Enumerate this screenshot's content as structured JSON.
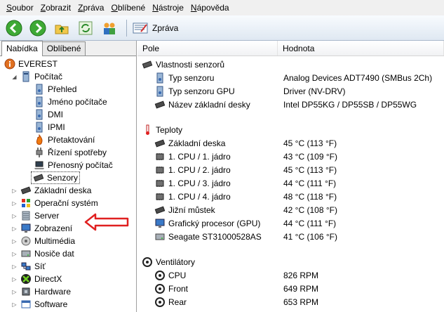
{
  "menu": [
    {
      "u": "S",
      "rest": "oubor"
    },
    {
      "u": "Z",
      "rest": "obrazit"
    },
    {
      "u": "Z",
      "rest": "práva"
    },
    {
      "u": "O",
      "rest": "blíbené"
    },
    {
      "u": "N",
      "rest": "ástroje"
    },
    {
      "u": "N",
      "rest": "ápověda"
    }
  ],
  "toolbar": {
    "title": "Zpráva"
  },
  "tabs": {
    "tab1": "Nabídka",
    "tab2": "Oblíbené"
  },
  "tree": {
    "root": "EVEREST",
    "computer": "Počítač",
    "items": [
      "Přehled",
      "Jméno počítače",
      "DMI",
      "IPMI",
      "Přetaktování",
      "Řízení spotřeby",
      "Přenosný počítač",
      "Senzory"
    ],
    "groups": [
      "Základní deska",
      "Operační systém",
      "Server",
      "Zobrazení",
      "Multimédia",
      "Nosiče dat",
      "Síť",
      "DirectX",
      "Hardware",
      "Software"
    ]
  },
  "columns": {
    "field": "Pole",
    "value": "Hodnota"
  },
  "sections": {
    "props": "Vlastnosti senzorů",
    "temps": "Teploty",
    "fans": "Ventilátory"
  },
  "props": [
    {
      "label": "Typ senzoru",
      "value": "Analog Devices ADT7490  (SMBus 2Ch)"
    },
    {
      "label": "Typ senzoru GPU",
      "value": "Driver  (NV-DRV)"
    },
    {
      "label": "Název základní desky",
      "value": "Intel DP55KG / DP55SB / DP55WG"
    }
  ],
  "temps": [
    {
      "label": "Základní deska",
      "value": "45 °C  (113 °F)"
    },
    {
      "label": "1. CPU / 1. jádro",
      "value": "43 °C  (109 °F)"
    },
    {
      "label": "1. CPU / 2. jádro",
      "value": "45 °C  (113 °F)"
    },
    {
      "label": "1. CPU / 3. jádro",
      "value": "44 °C  (111 °F)"
    },
    {
      "label": "1. CPU / 4. jádro",
      "value": "48 °C  (118 °F)"
    },
    {
      "label": "Jižní můstek",
      "value": "42 °C  (108 °F)"
    },
    {
      "label": "Grafický procesor (GPU)",
      "value": "44 °C  (111 °F)"
    },
    {
      "label": "Seagate ST31000528AS",
      "value": "41 °C  (106 °F)"
    }
  ],
  "fans": [
    {
      "label": "CPU",
      "value": "826 RPM"
    },
    {
      "label": "Front",
      "value": "649 RPM"
    },
    {
      "label": "Rear",
      "value": "653 RPM"
    }
  ]
}
